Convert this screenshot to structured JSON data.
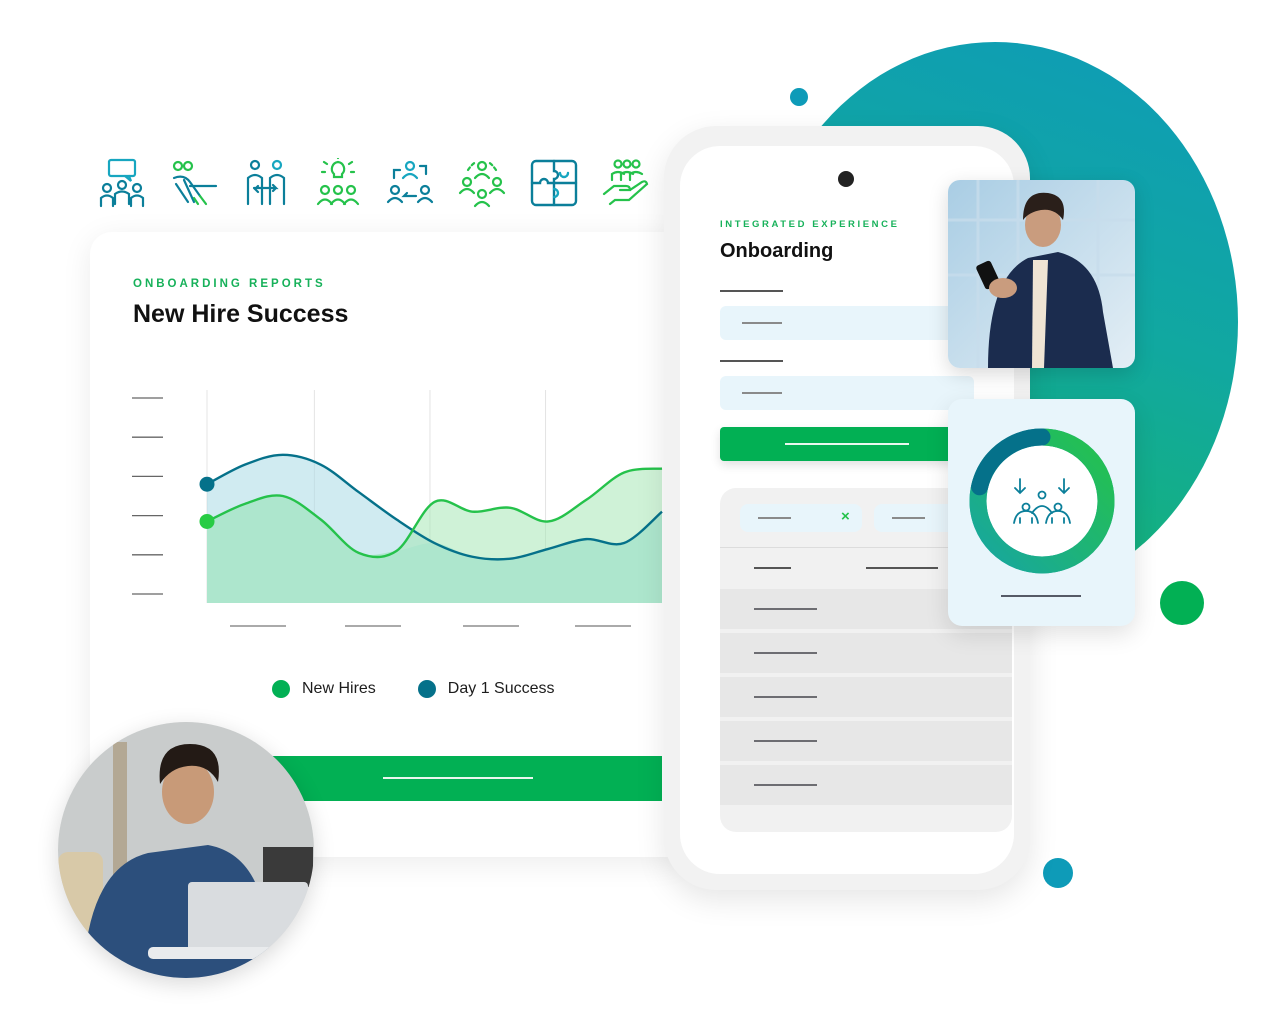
{
  "colors": {
    "brand_green": "#02b054",
    "teal": "#05718a",
    "light_blue_field": "#e8f5fb",
    "blob_top": "#0e9bb8",
    "blob_bottom": "#19b56b",
    "accent_dot_blue": "#0e9bb8",
    "accent_dot_green": "#02b054"
  },
  "icon_row": [
    {
      "name": "team-meeting-icon"
    },
    {
      "name": "tug-of-war-icon"
    },
    {
      "name": "exchange-people-icon"
    },
    {
      "name": "idea-team-icon"
    },
    {
      "name": "rotation-people-icon"
    },
    {
      "name": "network-people-icon"
    },
    {
      "name": "puzzle-icon"
    },
    {
      "name": "hand-people-icon"
    }
  ],
  "report_card": {
    "eyebrow": "ONBOARDING REPORTS",
    "title": "New Hire Success",
    "legend": [
      {
        "label": "New Hires",
        "color": "#17b15a"
      },
      {
        "label": "Day 1 Success",
        "color": "#05718a"
      }
    ],
    "action_button": {
      "label": ""
    }
  },
  "chart_data": {
    "type": "area",
    "title": "New Hire Success",
    "xlabel": "",
    "ylabel": "",
    "x": [
      0,
      1,
      2,
      3,
      4,
      5,
      6,
      7,
      8,
      9,
      10,
      11,
      12
    ],
    "x_tick_labels": [
      "",
      "",
      "",
      ""
    ],
    "y_tick_labels": [
      "",
      "",
      "",
      "",
      "",
      ""
    ],
    "ylim": [
      0,
      5
    ],
    "grid": "vertical",
    "legend_position": "bottom",
    "series": [
      {
        "name": "Day 1 Success",
        "color": "#05718a",
        "fill": "#d1ebf1",
        "values": [
          2.8,
          3.3,
          3.55,
          3.3,
          2.6,
          1.9,
          1.3,
          0.95,
          0.9,
          1.15,
          1.4,
          1.3,
          2.1
        ]
      },
      {
        "name": "New Hires",
        "color": "#25c24b",
        "fill": "#d2f4d8",
        "values": [
          1.85,
          2.3,
          2.5,
          1.9,
          1.05,
          1.1,
          2.35,
          2.1,
          2.2,
          1.85,
          2.4,
          3.1,
          3.2
        ]
      }
    ]
  },
  "phone": {
    "eyebrow": "INTEGRATED EXPERIENCE",
    "title": "Onboarding",
    "fields": [
      {
        "label": "",
        "value": ""
      },
      {
        "label": "",
        "value": ""
      }
    ],
    "submit_button": {
      "label": ""
    },
    "filter_chips": [
      {
        "label": "",
        "close": "×"
      },
      {
        "label": ""
      }
    ],
    "table_header": [
      "",
      ""
    ],
    "table_rows": [
      "",
      "",
      "",
      "",
      ""
    ]
  },
  "donut_card": {
    "progress_fraction": 0.86,
    "icon": "team-onboarding-icon",
    "caption": ""
  },
  "photos": {
    "top_right": "person-with-phone",
    "bottom_left": "person-with-laptop"
  }
}
